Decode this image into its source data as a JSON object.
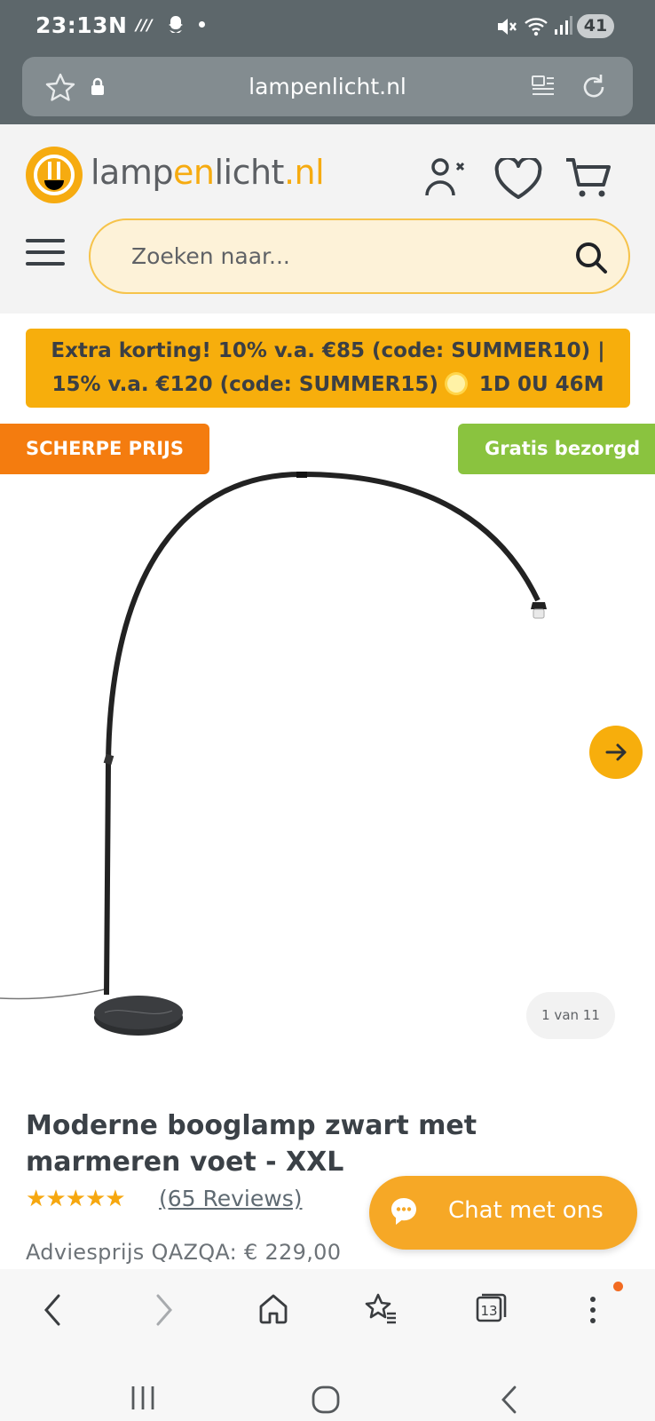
{
  "status_bar": {
    "time": "23:13",
    "notification_app": "N",
    "notification_wave": "///",
    "battery": "41"
  },
  "browser": {
    "url": "lampenlicht.nl",
    "tab_count": "13"
  },
  "site": {
    "logo": {
      "part1": "lamp",
      "part2": "en",
      "part3": "licht",
      "part4": ".nl"
    },
    "search_placeholder": "Zoeken naar..."
  },
  "promo": {
    "line1": "Extra korting! 10% v.a. €85 (code: SUMMER10) |",
    "line2_text": "15% v.a. €120 (code: SUMMER15)",
    "countdown": "1D 0U 46M"
  },
  "gallery": {
    "badge_left": "SCHERPE PRIJS",
    "badge_right": "Gratis bezorgd",
    "counter": "1 van 11"
  },
  "product": {
    "title": "Moderne booglamp zwart met marmeren voet - XXL",
    "rating": 5,
    "reviews": "(65 Reviews)",
    "msrp": "Adviesprijs QAZQA: € 229,00"
  },
  "chat": {
    "label": "Chat met ons"
  },
  "colors": {
    "brand_yellow": "#f7ae0c",
    "badge_orange": "#f47c0f",
    "badge_green": "#8ac33f",
    "browser_chrome": "#5d676b"
  }
}
